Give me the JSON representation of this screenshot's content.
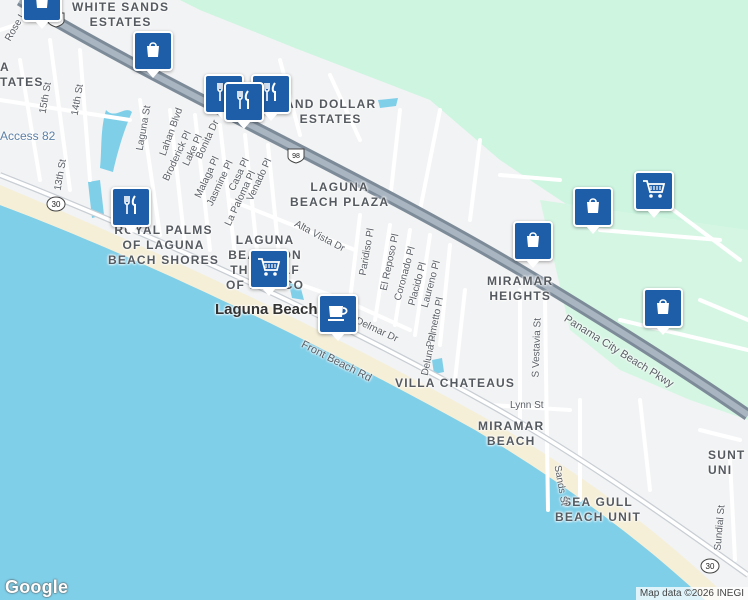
{
  "map": {
    "colors": {
      "land": "#f2f3f4",
      "water": "#7fcfe9",
      "park": "#cdf5e0",
      "beach": "#f5efd8",
      "highway": "#8c9aa8",
      "pin": "#1e5ea8"
    },
    "areas": {
      "white_sands": "WHITE SANDS\nESTATES",
      "estates_left": "A\nTATES",
      "sand_dollar": "AND DOLLAR\nESTATES",
      "laguna_plaza": "LAGUNA\nBEACH PLAZA",
      "royal_palms": "ROYAL PALMS\nOF LAGUNA\nBEACH SHORES",
      "laguna_gulf": "LAGUNA\nBEACH ON\nTHE GULF\nOF MEXICO",
      "miramar_heights": "MIRAMAR\nHEIGHTS",
      "villa_chateaus": "VILLA CHATEAUS",
      "miramar_beach": "MIRAMAR\nBEACH",
      "sea_gull": "SEA GULL\nBEACH UNIT",
      "sunt": "SUNT\nUNI"
    },
    "city": "Laguna Beach",
    "access_label": "Access 82",
    "streets": {
      "rose_ln": "Rose Ln",
      "15th": "15th St",
      "14th": "14th St",
      "13th": "13th St",
      "laguna_st": "Laguna St",
      "lahan": "Lahan Blvd",
      "broderick": "Broderick Pl",
      "lake": "Lake Pl",
      "bonita": "Bonita Dr",
      "malaga": "Malaga Pl",
      "jasmine": "Jasmine Pl",
      "casa": "Casa Pl",
      "la_paloma": "La Paloma Pl",
      "venado": "Venado Pl",
      "alta_vista": "Alta Vista Dr",
      "paridiso": "Paridiso Pl",
      "el_reposo": "El Reposo Pl",
      "coronado": "Coronado Pl",
      "placido": "Placido Pl",
      "laureno": "Laureno Pl",
      "palmetto": "Palmetto Pl",
      "deluna": "Deluna Pl",
      "delmar": "Delmar Dr",
      "front_beach": "Front Beach Rd",
      "pcb_pkwy": "Panama City Beach Pkwy",
      "s_vestavia": "S Vestavia St",
      "lynn": "Lynn St",
      "sands": "Sands St",
      "sundial": "Sundial St"
    },
    "shields": {
      "us98_top": "98",
      "us98_mid": "98",
      "sr30_left": "30",
      "sr30_right": "30"
    },
    "pins": [
      {
        "icon": "shopping-bag-icon",
        "label": "shopping"
      },
      {
        "icon": "restaurant-icon",
        "label": "restaurant"
      },
      {
        "icon": "restaurant-icon",
        "label": "restaurant"
      },
      {
        "icon": "restaurant-icon",
        "label": "restaurant"
      },
      {
        "icon": "restaurant-icon",
        "label": "restaurant"
      },
      {
        "icon": "shopping-cart-icon",
        "label": "grocery"
      },
      {
        "icon": "coffee-cup-icon",
        "label": "cafe"
      },
      {
        "icon": "shopping-bag-icon",
        "label": "shopping"
      },
      {
        "icon": "shopping-bag-icon",
        "label": "shopping"
      },
      {
        "icon": "shopping-cart-icon",
        "label": "grocery"
      },
      {
        "icon": "shopping-bag-icon",
        "label": "shopping"
      }
    ],
    "footer": {
      "logo": "Google",
      "attribution": "Map data ©2026 INEGI"
    }
  }
}
